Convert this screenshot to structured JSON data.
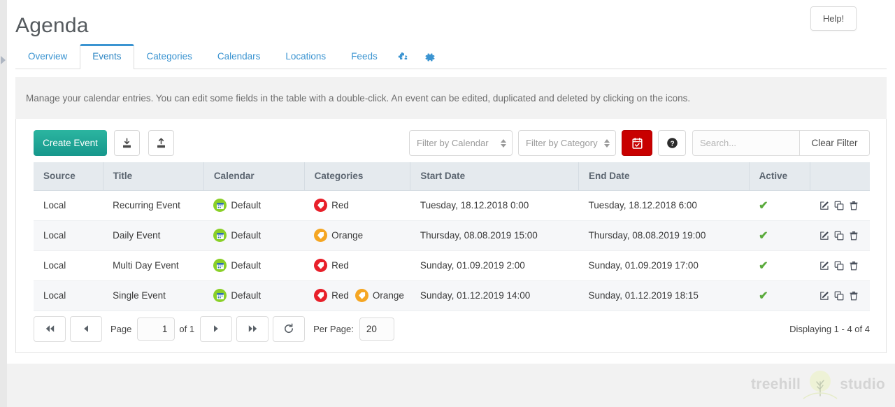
{
  "header": {
    "title": "Agenda",
    "help_button": "Help!"
  },
  "tabs": [
    {
      "label": "Overview",
      "name": "tab-overview",
      "active": false
    },
    {
      "label": "Events",
      "name": "tab-events",
      "active": true
    },
    {
      "label": "Categories",
      "name": "tab-categories",
      "active": false
    },
    {
      "label": "Calendars",
      "name": "tab-calendars",
      "active": false
    },
    {
      "label": "Locations",
      "name": "tab-locations",
      "active": false
    },
    {
      "label": "Feeds",
      "name": "tab-feeds",
      "active": false
    }
  ],
  "tab_icons": [
    {
      "name": "plugin-icon"
    },
    {
      "name": "gear-icon"
    }
  ],
  "description": "Manage your calendar entries. You can edit some fields in the table with a double-click. An event can be edited, duplicated and deleted by clicking on the icons.",
  "toolbar": {
    "create_label": "Create Event",
    "download_icon": "download-icon",
    "upload_icon": "upload-icon",
    "filter_calendar": "Filter by Calendar",
    "filter_category": "Filter by Category",
    "date_filter_icon": "calendar-check-icon",
    "help_icon": "question-circle-icon",
    "search_placeholder": "Search...",
    "search_value": "",
    "clear_filter_label": "Clear Filter"
  },
  "table": {
    "headers": [
      "Source",
      "Title",
      "Calendar",
      "Categories",
      "Start Date",
      "End Date",
      "Active",
      ""
    ],
    "rows": [
      {
        "source": "Local",
        "title": "Recurring Event",
        "calendar": "Default",
        "categories": [
          {
            "label": "Red",
            "color": "red"
          }
        ],
        "start": "Tuesday, 18.12.2018 0:00",
        "end": "Tuesday, 18.12.2018 6:00",
        "active": true
      },
      {
        "source": "Local",
        "title": "Daily Event",
        "calendar": "Default",
        "categories": [
          {
            "label": "Orange",
            "color": "orange"
          }
        ],
        "start": "Thursday, 08.08.2019 15:00",
        "end": "Thursday, 08.08.2019 19:00",
        "active": true
      },
      {
        "source": "Local",
        "title": "Multi Day Event",
        "calendar": "Default",
        "categories": [
          {
            "label": "Red",
            "color": "red"
          }
        ],
        "start": "Sunday, 01.09.2019 2:00",
        "end": "Sunday, 01.09.2019 17:00",
        "active": true
      },
      {
        "source": "Local",
        "title": "Single Event",
        "calendar": "Default",
        "categories": [
          {
            "label": "Red",
            "color": "red"
          },
          {
            "label": "Orange",
            "color": "orange"
          }
        ],
        "start": "Sunday, 01.12.2019 14:00",
        "end": "Sunday, 01.12.2019 18:15",
        "active": true
      }
    ],
    "row_action_icons": [
      "edit-icon",
      "duplicate-icon",
      "delete-icon"
    ]
  },
  "pager": {
    "first_icon": "first-page-icon",
    "prev_icon": "prev-page-icon",
    "page_label": "Page",
    "page_value": "1",
    "of_label": "of 1",
    "next_icon": "next-page-icon",
    "last_icon": "last-page-icon",
    "refresh_icon": "refresh-icon",
    "per_page_label": "Per Page:",
    "per_page_value": "20",
    "displaying": "Displaying 1 - 4 of 4"
  },
  "footer": {
    "logo_left": "treehill",
    "logo_right": "studio",
    "logo_icon": "tree-logo-icon"
  },
  "colors": {
    "accent_blue": "#3b94d1",
    "create_green": "#16978c",
    "date_red": "#c80000",
    "calendar_badge_green": "#8ad028",
    "category_red": "#e8202a",
    "category_orange": "#f5a623",
    "active_check_green": "#5cab3e"
  }
}
